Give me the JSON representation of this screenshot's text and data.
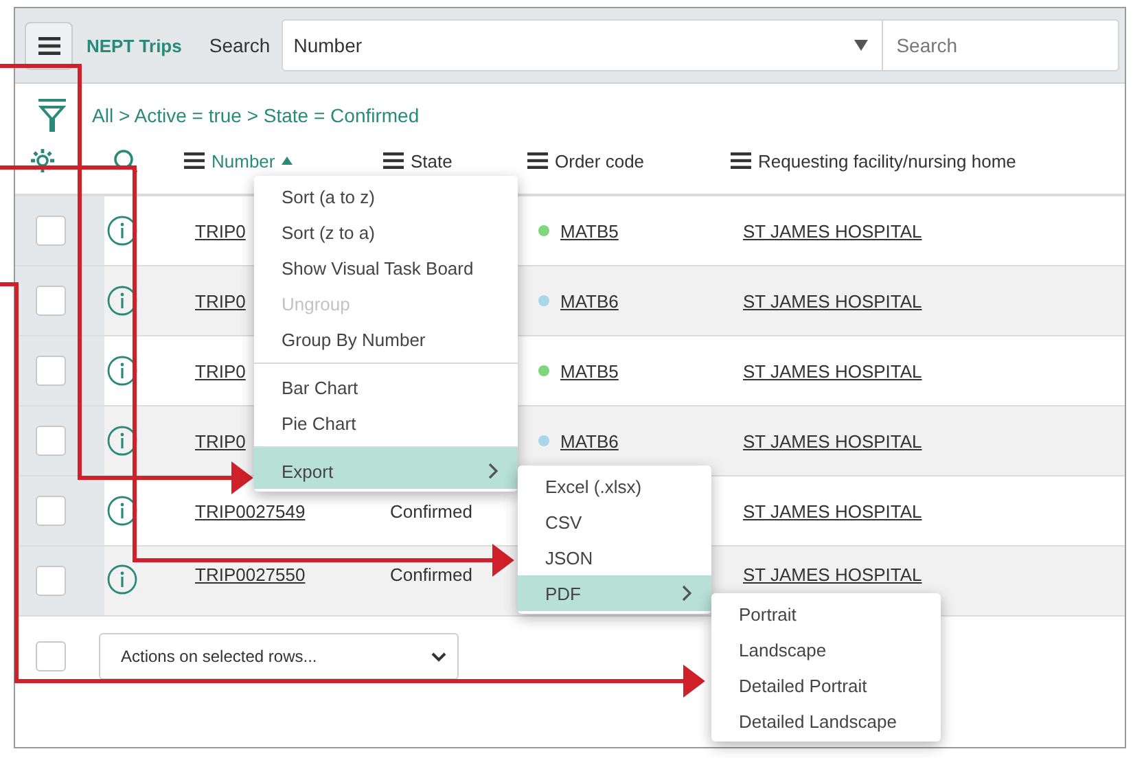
{
  "header": {
    "app_title": "NEPT Trips",
    "search_label": "Search",
    "search_field": {
      "value": "Number"
    },
    "search_box": {
      "placeholder": "Search"
    }
  },
  "breadcrumb": "All > Active = true > State = Confirmed",
  "columns": [
    {
      "label": "Number",
      "sorted": true
    },
    {
      "label": "State",
      "sorted": false
    },
    {
      "label": "Order code",
      "sorted": false
    },
    {
      "label": "Requesting facility/nursing home",
      "sorted": false
    }
  ],
  "rows": [
    {
      "checked": false,
      "number": "TRIP0",
      "order_code": "MATB5",
      "color": "#7ed67e",
      "facility": "ST JAMES HOSPITAL"
    },
    {
      "checked": false,
      "number": "TRIP0",
      "order_code": "MATB6",
      "color": "#a9d6e8",
      "facility": "ST JAMES HOSPITAL"
    },
    {
      "checked": false,
      "number": "TRIP0",
      "order_code": "MATB5",
      "color": "#7ed67e",
      "facility": "ST JAMES HOSPITAL"
    },
    {
      "checked": false,
      "number": "TRIP0",
      "order_code": "MATB6",
      "color": "#a9d6e8",
      "facility": "ST JAMES HOSPITAL"
    },
    {
      "checked": false,
      "number": "TRIP0027549",
      "state": "Confirmed",
      "facility": "ST JAMES HOSPITAL"
    },
    {
      "checked": false,
      "number": "TRIP0027550",
      "state": "Confirmed",
      "facility": "ST JAMES HOSPITAL"
    }
  ],
  "footer": {
    "checked": false,
    "actions": "Actions on selected rows..."
  },
  "context_menu": [
    {
      "label": "Sort (a to z)",
      "disabled": false,
      "selected": false,
      "submenu": false,
      "divider_before": false
    },
    {
      "label": "Sort (z to a)",
      "disabled": false,
      "selected": false,
      "submenu": false,
      "divider_before": false
    },
    {
      "label": "Show Visual Task Board",
      "disabled": false,
      "selected": false,
      "submenu": false,
      "divider_before": false
    },
    {
      "label": "Ungroup",
      "disabled": true,
      "selected": false,
      "submenu": false,
      "divider_before": false
    },
    {
      "label": "Group By Number",
      "disabled": false,
      "selected": false,
      "submenu": false,
      "divider_before": false
    },
    {
      "label": "Bar Chart",
      "disabled": false,
      "selected": false,
      "submenu": false,
      "divider_before": true
    },
    {
      "label": "Pie Chart",
      "disabled": false,
      "selected": false,
      "submenu": false,
      "divider_before": false
    },
    {
      "label": "Export",
      "disabled": false,
      "selected": true,
      "submenu": true,
      "divider_before": true
    }
  ],
  "export_menu": [
    {
      "label": "Excel (.xlsx)",
      "disabled": false,
      "selected": false,
      "submenu": false,
      "divider_before": false
    },
    {
      "label": "CSV",
      "disabled": false,
      "selected": false,
      "submenu": false,
      "divider_before": false
    },
    {
      "label": "JSON",
      "disabled": false,
      "selected": false,
      "submenu": false,
      "divider_before": false
    },
    {
      "label": "PDF",
      "disabled": false,
      "selected": true,
      "submenu": true,
      "divider_before": false
    }
  ],
  "pdf_menu": [
    {
      "label": "Portrait",
      "disabled": false,
      "selected": false,
      "submenu": false,
      "divider_before": false
    },
    {
      "label": "Landscape",
      "disabled": false,
      "selected": false,
      "submenu": false,
      "divider_before": false
    },
    {
      "label": "Detailed Portrait",
      "disabled": false,
      "selected": false,
      "submenu": false,
      "divider_before": false
    },
    {
      "label": "Detailed Landscape",
      "disabled": false,
      "selected": false,
      "submenu": false,
      "divider_before": false
    }
  ]
}
